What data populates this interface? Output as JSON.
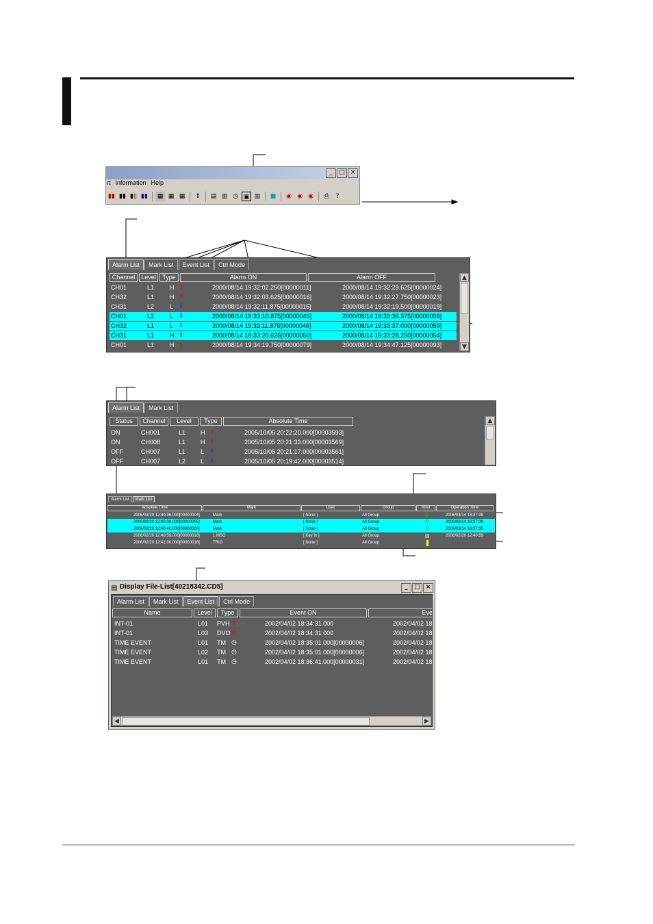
{
  "toolbar_window": {
    "menu": [
      "rt",
      "Information",
      "Help"
    ],
    "window_controls": [
      "_",
      "□",
      "×"
    ],
    "tool_icons": [
      "bar-chart-icon",
      "bar-chart-icon",
      "bar-chart-icon",
      "bar-chart-icon",
      "grid-icon",
      "grid-icon",
      "grid-icon",
      "sort-icon",
      "list-icon",
      "list-icon",
      "clock-icon",
      "event-icon",
      "table-icon",
      "color-icon",
      "record-icon",
      "record-icon",
      "record-icon",
      "print-icon",
      "help-icon"
    ]
  },
  "alarm_panel_1": {
    "tabs": [
      "Alarm List",
      "Mark List",
      "Event List",
      "Ctrl Mode"
    ],
    "headers": [
      "Channel",
      "Level",
      "Type",
      "Alarm ON",
      "Alarm OFF"
    ],
    "rows": [
      {
        "channel": "CH01",
        "level": "L1",
        "type": "H",
        "dir": "up",
        "on": "2000/08/14 19:32:02.250[00000011]",
        "off": "2000/08/14 19:32:29.625[00000024]",
        "hl": false
      },
      {
        "channel": "CH32",
        "level": "L1",
        "type": "H",
        "dir": "up",
        "on": "2000/08/14 19:32:03.625[00000016]",
        "off": "2000/08/14 19:32:27.750[00000023]",
        "hl": false
      },
      {
        "channel": "CH31",
        "level": "L2",
        "type": "L",
        "dir": "down",
        "on": "2000/08/14 19:32:11.875[00000015]",
        "off": "2000/08/14 19:32:19.500[00000019]",
        "hl": false
      },
      {
        "channel": "CH01",
        "level": "L2",
        "type": "L",
        "dir": "down",
        "on": "2000/08/14 19:33:10.875[00000045]",
        "off": "2000/08/14 19:33:36.375[00000059]",
        "hl": true
      },
      {
        "channel": "CH32",
        "level": "L1",
        "type": "L",
        "dir": "down",
        "on": "2000/08/14 19:33:11.875[00000046]",
        "off": "2000/08/14 19:33:37.000[00000059]",
        "hl": true
      },
      {
        "channel": "CH31",
        "level": "L1",
        "type": "H",
        "dir": "up",
        "on": "2000/08/14 19:33:20.625[00000050]",
        "off": "2000/08/14 19:33:28.250[00000054]",
        "hl": true
      },
      {
        "channel": "CH01",
        "level": "L1",
        "type": "H",
        "dir": "up",
        "on": "2000/08/14 19:34:19.750[00000079]",
        "off": "2000/08/14 19:34:47.125[00000093]",
        "hl": false
      }
    ]
  },
  "alarm_panel_2": {
    "tabs": [
      "Alarm List",
      "Mark List"
    ],
    "headers": [
      "Status",
      "Channel",
      "Level",
      "Type",
      "Absolute Time"
    ],
    "rows": [
      {
        "status": "ON",
        "channel": "CH001",
        "level": "L1",
        "type": "H",
        "dir": "up",
        "time": "2005/10/05 20:22:20.000[00003593]"
      },
      {
        "status": "ON",
        "channel": "CH008",
        "level": "L1",
        "type": "H",
        "dir": "up",
        "time": "2005/10/05 20:21:33.000[00003569]"
      },
      {
        "status": "OFF",
        "channel": "CH007",
        "level": "L1",
        "type": "L",
        "dir": "down",
        "time": "2005/10/05 20:21:17.000[00003561]"
      },
      {
        "status": "OFF",
        "channel": "CH007",
        "level": "L2",
        "type": "L",
        "dir": "down",
        "time": "2005/10/05 20:19:42.000[00003514]"
      }
    ]
  },
  "mark_panel": {
    "tabs": [
      "Alarm List",
      "Mark List"
    ],
    "headers": [
      "Absolute Time",
      "Mark",
      "User",
      "Group",
      "Kind",
      "Operation Time"
    ],
    "rows": [
      {
        "time": "2006/02/20 12:40:36.000[00000004]",
        "mark": "Mark",
        "user": "[ None ]",
        "group": "All Group",
        "kind": "ok",
        "op": "2006/03/14 18:37:39",
        "hl": false
      },
      {
        "time": "2006/02/20 12:40:38.000[00000005]",
        "mark": "Mark",
        "user": "[ None ]",
        "group": "All Group",
        "kind": "ok",
        "op": "2006/03/14 18:37:39",
        "hl": true
      },
      {
        "time": "2006/02/20 12:40:40.000[00000006]",
        "mark": "Mark",
        "user": "[ None ]",
        "group": "All Group",
        "kind": "ok",
        "op": "2006/03/14 18:37:35",
        "hl": true
      },
      {
        "time": "2006/02/20 12:40:59.000[00000016]",
        "mark": "1.MSG",
        "user": "[ Key In ]",
        "group": "All Group",
        "kind": "msg",
        "op": "2006/02/20 12:40:59",
        "hl": false
      },
      {
        "time": "2006/02/20 12:41:00.000[00000016]",
        "mark": "TRIG",
        "user": "[ None ]",
        "group": "All Group",
        "kind": "trig",
        "op": "",
        "hl": false
      }
    ]
  },
  "event_window": {
    "title": "Display File-List[40218342.CD5]",
    "tabs": [
      "Alarm List",
      "Mark List",
      "Event List",
      "Ctrl Mode"
    ],
    "headers": [
      "Name",
      "Level",
      "Type",
      "Event ON",
      "Even"
    ],
    "rows": [
      {
        "name": "INT-01",
        "level": "L01",
        "type": "PVH",
        "icon": "up",
        "on": "2002/04/02 18:34:31.000",
        "off": "2002/04/02 18:"
      },
      {
        "name": "INT-01",
        "level": "L03",
        "type": "DVO",
        "icon": "dvo",
        "on": "2002/04/02 18:34:31.000",
        "off": "2002/04/02 18:"
      },
      {
        "name": "TIME EVENT",
        "level": "L01",
        "type": "TM",
        "icon": "clock",
        "on": "2002/04/02 18:35:01.000[00000006]",
        "off": "2002/04/02 18:"
      },
      {
        "name": "TIME EVENT",
        "level": "L02",
        "type": "TM",
        "icon": "clock",
        "on": "2002/04/02 18:35:01.000[00000006]",
        "off": "2002/04/02 18:"
      },
      {
        "name": "TIME EVENT",
        "level": "L01",
        "type": "TM",
        "icon": "clock",
        "on": "2002/04/02 18:36:41.000[00000031]",
        "off": "2002/04/02 18:"
      }
    ]
  }
}
